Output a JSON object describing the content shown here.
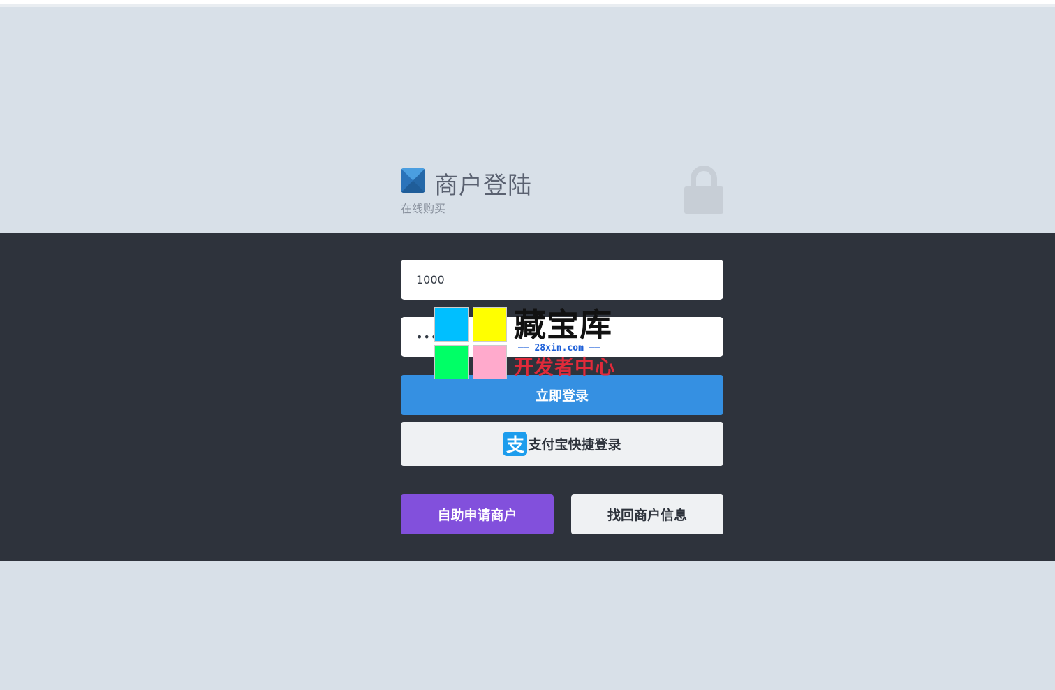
{
  "header": {
    "title": "商户登陆",
    "subtitle": "在线购买"
  },
  "form": {
    "username_value": "1000",
    "password_value": "••••••"
  },
  "buttons": {
    "login": "立即登录",
    "alipay_logo_glyph": "支",
    "alipay": "支付宝快捷登录",
    "apply": "自助申请商户",
    "recover": "找回商户信息"
  },
  "watermark": {
    "title": "藏宝库",
    "url": "—— 28xin.com ——",
    "subtitle": "开发者中心"
  },
  "colors": {
    "page_bg": "#d8e0e8",
    "band_bg": "#2e333c",
    "login_button": "#3590e2",
    "apply_button": "#8250dc",
    "alipay_blue": "#1d9ded"
  }
}
